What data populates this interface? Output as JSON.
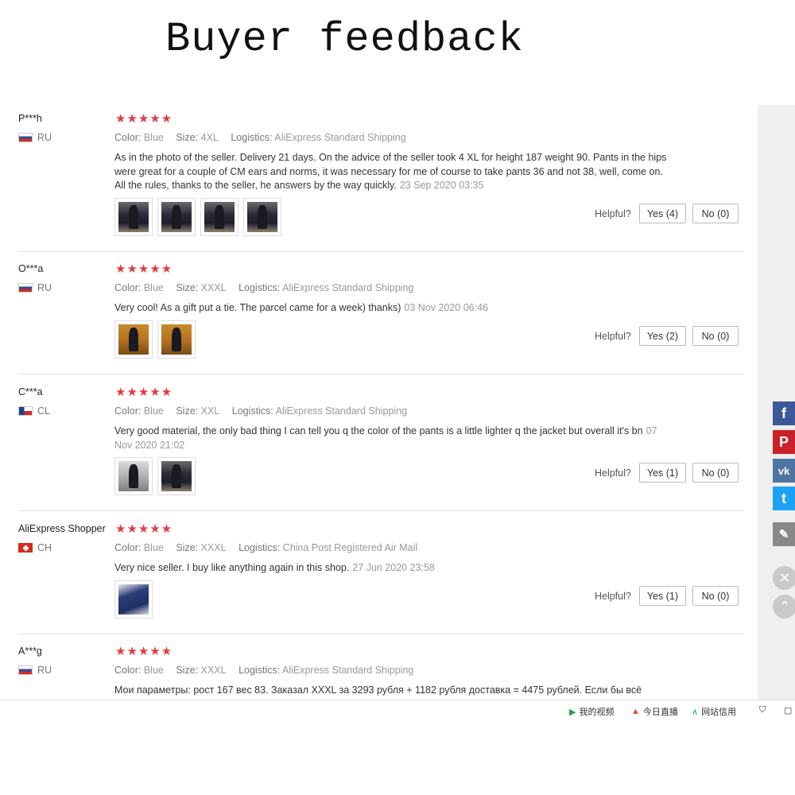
{
  "page_title": "Buyer feedback",
  "stars": "★★★★★",
  "labels": {
    "color": "Color:",
    "size": "Size:",
    "logistics": "Logistics:",
    "helpful": "Helpful?"
  },
  "reviews": [
    {
      "name": "P***h",
      "country": "RU",
      "color": "Blue",
      "size": "4XL",
      "logistics": "AliExpress Standard Shipping",
      "text": "As in the photo of the seller. Delivery 21 days. On the advice of the seller took 4 XL for height 187 weight 90. Pants in the hips were great for a couple of CM ears and norms, it was necessary for me of course to take pants 36 and not 38, well, come on. All the rules, thanks to the seller, he answers by the way quickly.",
      "date": "23 Sep 2020 03:35",
      "yes": "Yes (4)",
      "no": "No (0)"
    },
    {
      "name": "O***a",
      "country": "RU",
      "color": "Blue",
      "size": "XXXL",
      "logistics": "AliExpress Standard Shipping",
      "text": "Very cool! As a gift put a tie. The parcel came for a week) thanks)",
      "date": "03 Nov 2020 06:46",
      "yes": "Yes (2)",
      "no": "No (0)"
    },
    {
      "name": "C***a",
      "country": "CL",
      "color": "Blue",
      "size": "XXL",
      "logistics": "AliExpress Standard Shipping",
      "text": "Very good material, the only bad thing I can tell you q the color of the pants is a little lighter q the jacket but overall it's bn",
      "date": "07 Nov 2020 21:02",
      "yes": "Yes (1)",
      "no": "No (0)"
    },
    {
      "name": "AliExpress Shopper",
      "country": "CH",
      "color": "Blue",
      "size": "XXXL",
      "logistics": "China Post Registered Air Mail",
      "text": "Very nice seller. I buy like anything again in this shop.",
      "date": "27 Jun 2020 23:58",
      "yes": "Yes (1)",
      "no": "No (0)"
    },
    {
      "name": "A***g",
      "country": "RU",
      "color": "Blue",
      "size": "XXXL",
      "logistics": "AliExpress Standard Shipping",
      "text": "Мои параметры: рост 167 вес 83. Заказал XXXL за 3293 рубля + 1182 рубля доставка = 4475 рублей. Если бы всё"
    }
  ],
  "bottom_bar": {
    "video": "我的视频",
    "live": "今日直播",
    "credit": "网站信用"
  }
}
